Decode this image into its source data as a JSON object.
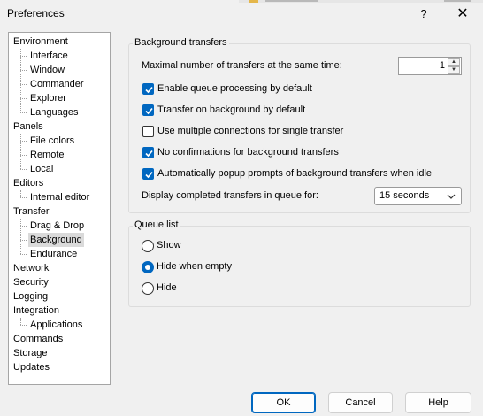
{
  "window": {
    "title": "Preferences",
    "help_glyph": "?",
    "close_glyph": "✕"
  },
  "tree": {
    "items": [
      {
        "label": "Environment",
        "level": 0
      },
      {
        "label": "Interface",
        "level": 1
      },
      {
        "label": "Window",
        "level": 1
      },
      {
        "label": "Commander",
        "level": 1
      },
      {
        "label": "Explorer",
        "level": 1
      },
      {
        "label": "Languages",
        "level": 1
      },
      {
        "label": "Panels",
        "level": 0
      },
      {
        "label": "File colors",
        "level": 1
      },
      {
        "label": "Remote",
        "level": 1
      },
      {
        "label": "Local",
        "level": 1
      },
      {
        "label": "Editors",
        "level": 0
      },
      {
        "label": "Internal editor",
        "level": 1
      },
      {
        "label": "Transfer",
        "level": 0
      },
      {
        "label": "Drag & Drop",
        "level": 1
      },
      {
        "label": "Background",
        "level": 1,
        "selected": true
      },
      {
        "label": "Endurance",
        "level": 1
      },
      {
        "label": "Network",
        "level": 0
      },
      {
        "label": "Security",
        "level": 0
      },
      {
        "label": "Logging",
        "level": 0
      },
      {
        "label": "Integration",
        "level": 0
      },
      {
        "label": "Applications",
        "level": 1
      },
      {
        "label": "Commands",
        "level": 0
      },
      {
        "label": "Storage",
        "level": 0
      },
      {
        "label": "Updates",
        "level": 0
      }
    ]
  },
  "background_transfers": {
    "caption": "Background transfers",
    "max_transfers_label": "Maximal number of transfers at the same time:",
    "max_transfers_value": "1",
    "checkboxes": [
      {
        "label": "Enable queue processing by default",
        "checked": true
      },
      {
        "label": "Transfer on background by default",
        "checked": true
      },
      {
        "label": "Use multiple connections for single transfer",
        "checked": false
      },
      {
        "label": "No confirmations for background transfers",
        "checked": true
      },
      {
        "label": "Automatically popup prompts of background transfers when idle",
        "checked": true
      }
    ],
    "display_completed_label": "Display completed transfers in queue for:",
    "display_completed_value": "15 seconds"
  },
  "queue_list": {
    "caption": "Queue list",
    "options": [
      {
        "label": "Show",
        "selected": false
      },
      {
        "label": "Hide when empty",
        "selected": true
      },
      {
        "label": "Hide",
        "selected": false
      }
    ]
  },
  "buttons": {
    "ok": "OK",
    "cancel": "Cancel",
    "help": "Help"
  },
  "colors": {
    "accent": "#0067c0",
    "selection": "#dadada",
    "window_bg": "#f0f0f0"
  }
}
